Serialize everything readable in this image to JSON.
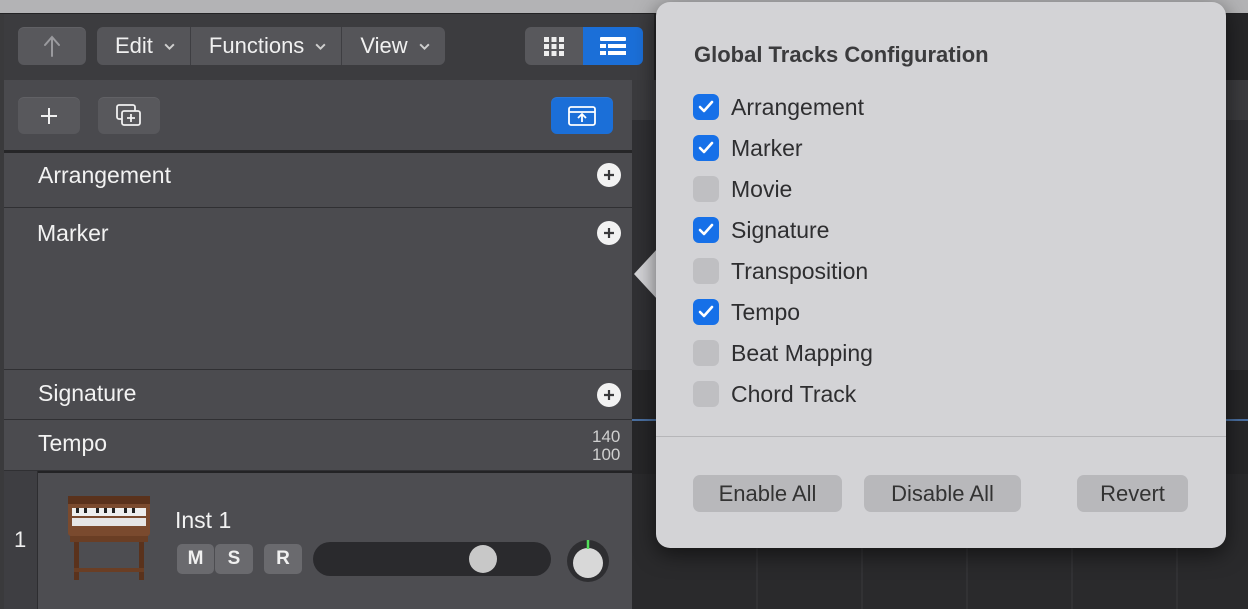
{
  "toolbar": {
    "back_icon": "back-arrow-icon",
    "edit_label": "Edit",
    "functions_label": "Functions",
    "view_label": "View"
  },
  "global_tracks": [
    {
      "name": "Arrangement",
      "has_add": true
    },
    {
      "name": "Marker",
      "has_add": true
    },
    {
      "name": "Signature",
      "has_add": true
    },
    {
      "name": "Tempo",
      "has_add": false
    }
  ],
  "tempo": {
    "max": "140",
    "min": "100"
  },
  "instrument_track": {
    "number": "1",
    "name": "Inst 1",
    "mute_label": "M",
    "solo_label": "S",
    "record_label": "R",
    "volume_level": 0.72
  },
  "popover": {
    "title": "Global Tracks Configuration",
    "options": [
      {
        "label": "Arrangement",
        "checked": true
      },
      {
        "label": "Marker",
        "checked": true
      },
      {
        "label": "Movie",
        "checked": false
      },
      {
        "label": "Signature",
        "checked": true
      },
      {
        "label": "Transposition",
        "checked": false
      },
      {
        "label": "Tempo",
        "checked": true
      },
      {
        "label": "Beat Mapping",
        "checked": false
      },
      {
        "label": "Chord Track",
        "checked": false
      }
    ],
    "enable_all_label": "Enable All",
    "disable_all_label": "Disable All",
    "revert_label": "Revert"
  },
  "colors": {
    "accent": "#1b6fd8",
    "popover_bg": "#d3d3d6",
    "panel_bg": "#4b4b4f"
  }
}
